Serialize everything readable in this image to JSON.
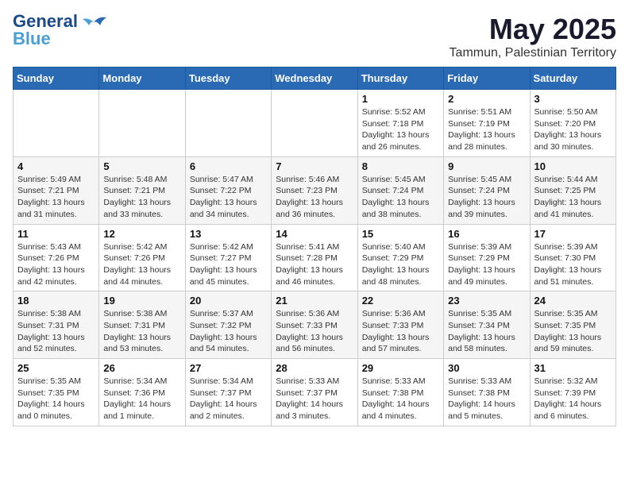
{
  "header": {
    "logo_line1": "General",
    "logo_line2": "Blue",
    "month": "May 2025",
    "location": "Tammun, Palestinian Territory"
  },
  "weekdays": [
    "Sunday",
    "Monday",
    "Tuesday",
    "Wednesday",
    "Thursday",
    "Friday",
    "Saturday"
  ],
  "weeks": [
    [
      {
        "day": "",
        "info": ""
      },
      {
        "day": "",
        "info": ""
      },
      {
        "day": "",
        "info": ""
      },
      {
        "day": "",
        "info": ""
      },
      {
        "day": "1",
        "info": "Sunrise: 5:52 AM\nSunset: 7:18 PM\nDaylight: 13 hours\nand 26 minutes."
      },
      {
        "day": "2",
        "info": "Sunrise: 5:51 AM\nSunset: 7:19 PM\nDaylight: 13 hours\nand 28 minutes."
      },
      {
        "day": "3",
        "info": "Sunrise: 5:50 AM\nSunset: 7:20 PM\nDaylight: 13 hours\nand 30 minutes."
      }
    ],
    [
      {
        "day": "4",
        "info": "Sunrise: 5:49 AM\nSunset: 7:21 PM\nDaylight: 13 hours\nand 31 minutes."
      },
      {
        "day": "5",
        "info": "Sunrise: 5:48 AM\nSunset: 7:21 PM\nDaylight: 13 hours\nand 33 minutes."
      },
      {
        "day": "6",
        "info": "Sunrise: 5:47 AM\nSunset: 7:22 PM\nDaylight: 13 hours\nand 34 minutes."
      },
      {
        "day": "7",
        "info": "Sunrise: 5:46 AM\nSunset: 7:23 PM\nDaylight: 13 hours\nand 36 minutes."
      },
      {
        "day": "8",
        "info": "Sunrise: 5:45 AM\nSunset: 7:24 PM\nDaylight: 13 hours\nand 38 minutes."
      },
      {
        "day": "9",
        "info": "Sunrise: 5:45 AM\nSunset: 7:24 PM\nDaylight: 13 hours\nand 39 minutes."
      },
      {
        "day": "10",
        "info": "Sunrise: 5:44 AM\nSunset: 7:25 PM\nDaylight: 13 hours\nand 41 minutes."
      }
    ],
    [
      {
        "day": "11",
        "info": "Sunrise: 5:43 AM\nSunset: 7:26 PM\nDaylight: 13 hours\nand 42 minutes."
      },
      {
        "day": "12",
        "info": "Sunrise: 5:42 AM\nSunset: 7:26 PM\nDaylight: 13 hours\nand 44 minutes."
      },
      {
        "day": "13",
        "info": "Sunrise: 5:42 AM\nSunset: 7:27 PM\nDaylight: 13 hours\nand 45 minutes."
      },
      {
        "day": "14",
        "info": "Sunrise: 5:41 AM\nSunset: 7:28 PM\nDaylight: 13 hours\nand 46 minutes."
      },
      {
        "day": "15",
        "info": "Sunrise: 5:40 AM\nSunset: 7:29 PM\nDaylight: 13 hours\nand 48 minutes."
      },
      {
        "day": "16",
        "info": "Sunrise: 5:39 AM\nSunset: 7:29 PM\nDaylight: 13 hours\nand 49 minutes."
      },
      {
        "day": "17",
        "info": "Sunrise: 5:39 AM\nSunset: 7:30 PM\nDaylight: 13 hours\nand 51 minutes."
      }
    ],
    [
      {
        "day": "18",
        "info": "Sunrise: 5:38 AM\nSunset: 7:31 PM\nDaylight: 13 hours\nand 52 minutes."
      },
      {
        "day": "19",
        "info": "Sunrise: 5:38 AM\nSunset: 7:31 PM\nDaylight: 13 hours\nand 53 minutes."
      },
      {
        "day": "20",
        "info": "Sunrise: 5:37 AM\nSunset: 7:32 PM\nDaylight: 13 hours\nand 54 minutes."
      },
      {
        "day": "21",
        "info": "Sunrise: 5:36 AM\nSunset: 7:33 PM\nDaylight: 13 hours\nand 56 minutes."
      },
      {
        "day": "22",
        "info": "Sunrise: 5:36 AM\nSunset: 7:33 PM\nDaylight: 13 hours\nand 57 minutes."
      },
      {
        "day": "23",
        "info": "Sunrise: 5:35 AM\nSunset: 7:34 PM\nDaylight: 13 hours\nand 58 minutes."
      },
      {
        "day": "24",
        "info": "Sunrise: 5:35 AM\nSunset: 7:35 PM\nDaylight: 13 hours\nand 59 minutes."
      }
    ],
    [
      {
        "day": "25",
        "info": "Sunrise: 5:35 AM\nSunset: 7:35 PM\nDaylight: 14 hours\nand 0 minutes."
      },
      {
        "day": "26",
        "info": "Sunrise: 5:34 AM\nSunset: 7:36 PM\nDaylight: 14 hours\nand 1 minute."
      },
      {
        "day": "27",
        "info": "Sunrise: 5:34 AM\nSunset: 7:37 PM\nDaylight: 14 hours\nand 2 minutes."
      },
      {
        "day": "28",
        "info": "Sunrise: 5:33 AM\nSunset: 7:37 PM\nDaylight: 14 hours\nand 3 minutes."
      },
      {
        "day": "29",
        "info": "Sunrise: 5:33 AM\nSunset: 7:38 PM\nDaylight: 14 hours\nand 4 minutes."
      },
      {
        "day": "30",
        "info": "Sunrise: 5:33 AM\nSunset: 7:38 PM\nDaylight: 14 hours\nand 5 minutes."
      },
      {
        "day": "31",
        "info": "Sunrise: 5:32 AM\nSunset: 7:39 PM\nDaylight: 14 hours\nand 6 minutes."
      }
    ]
  ]
}
